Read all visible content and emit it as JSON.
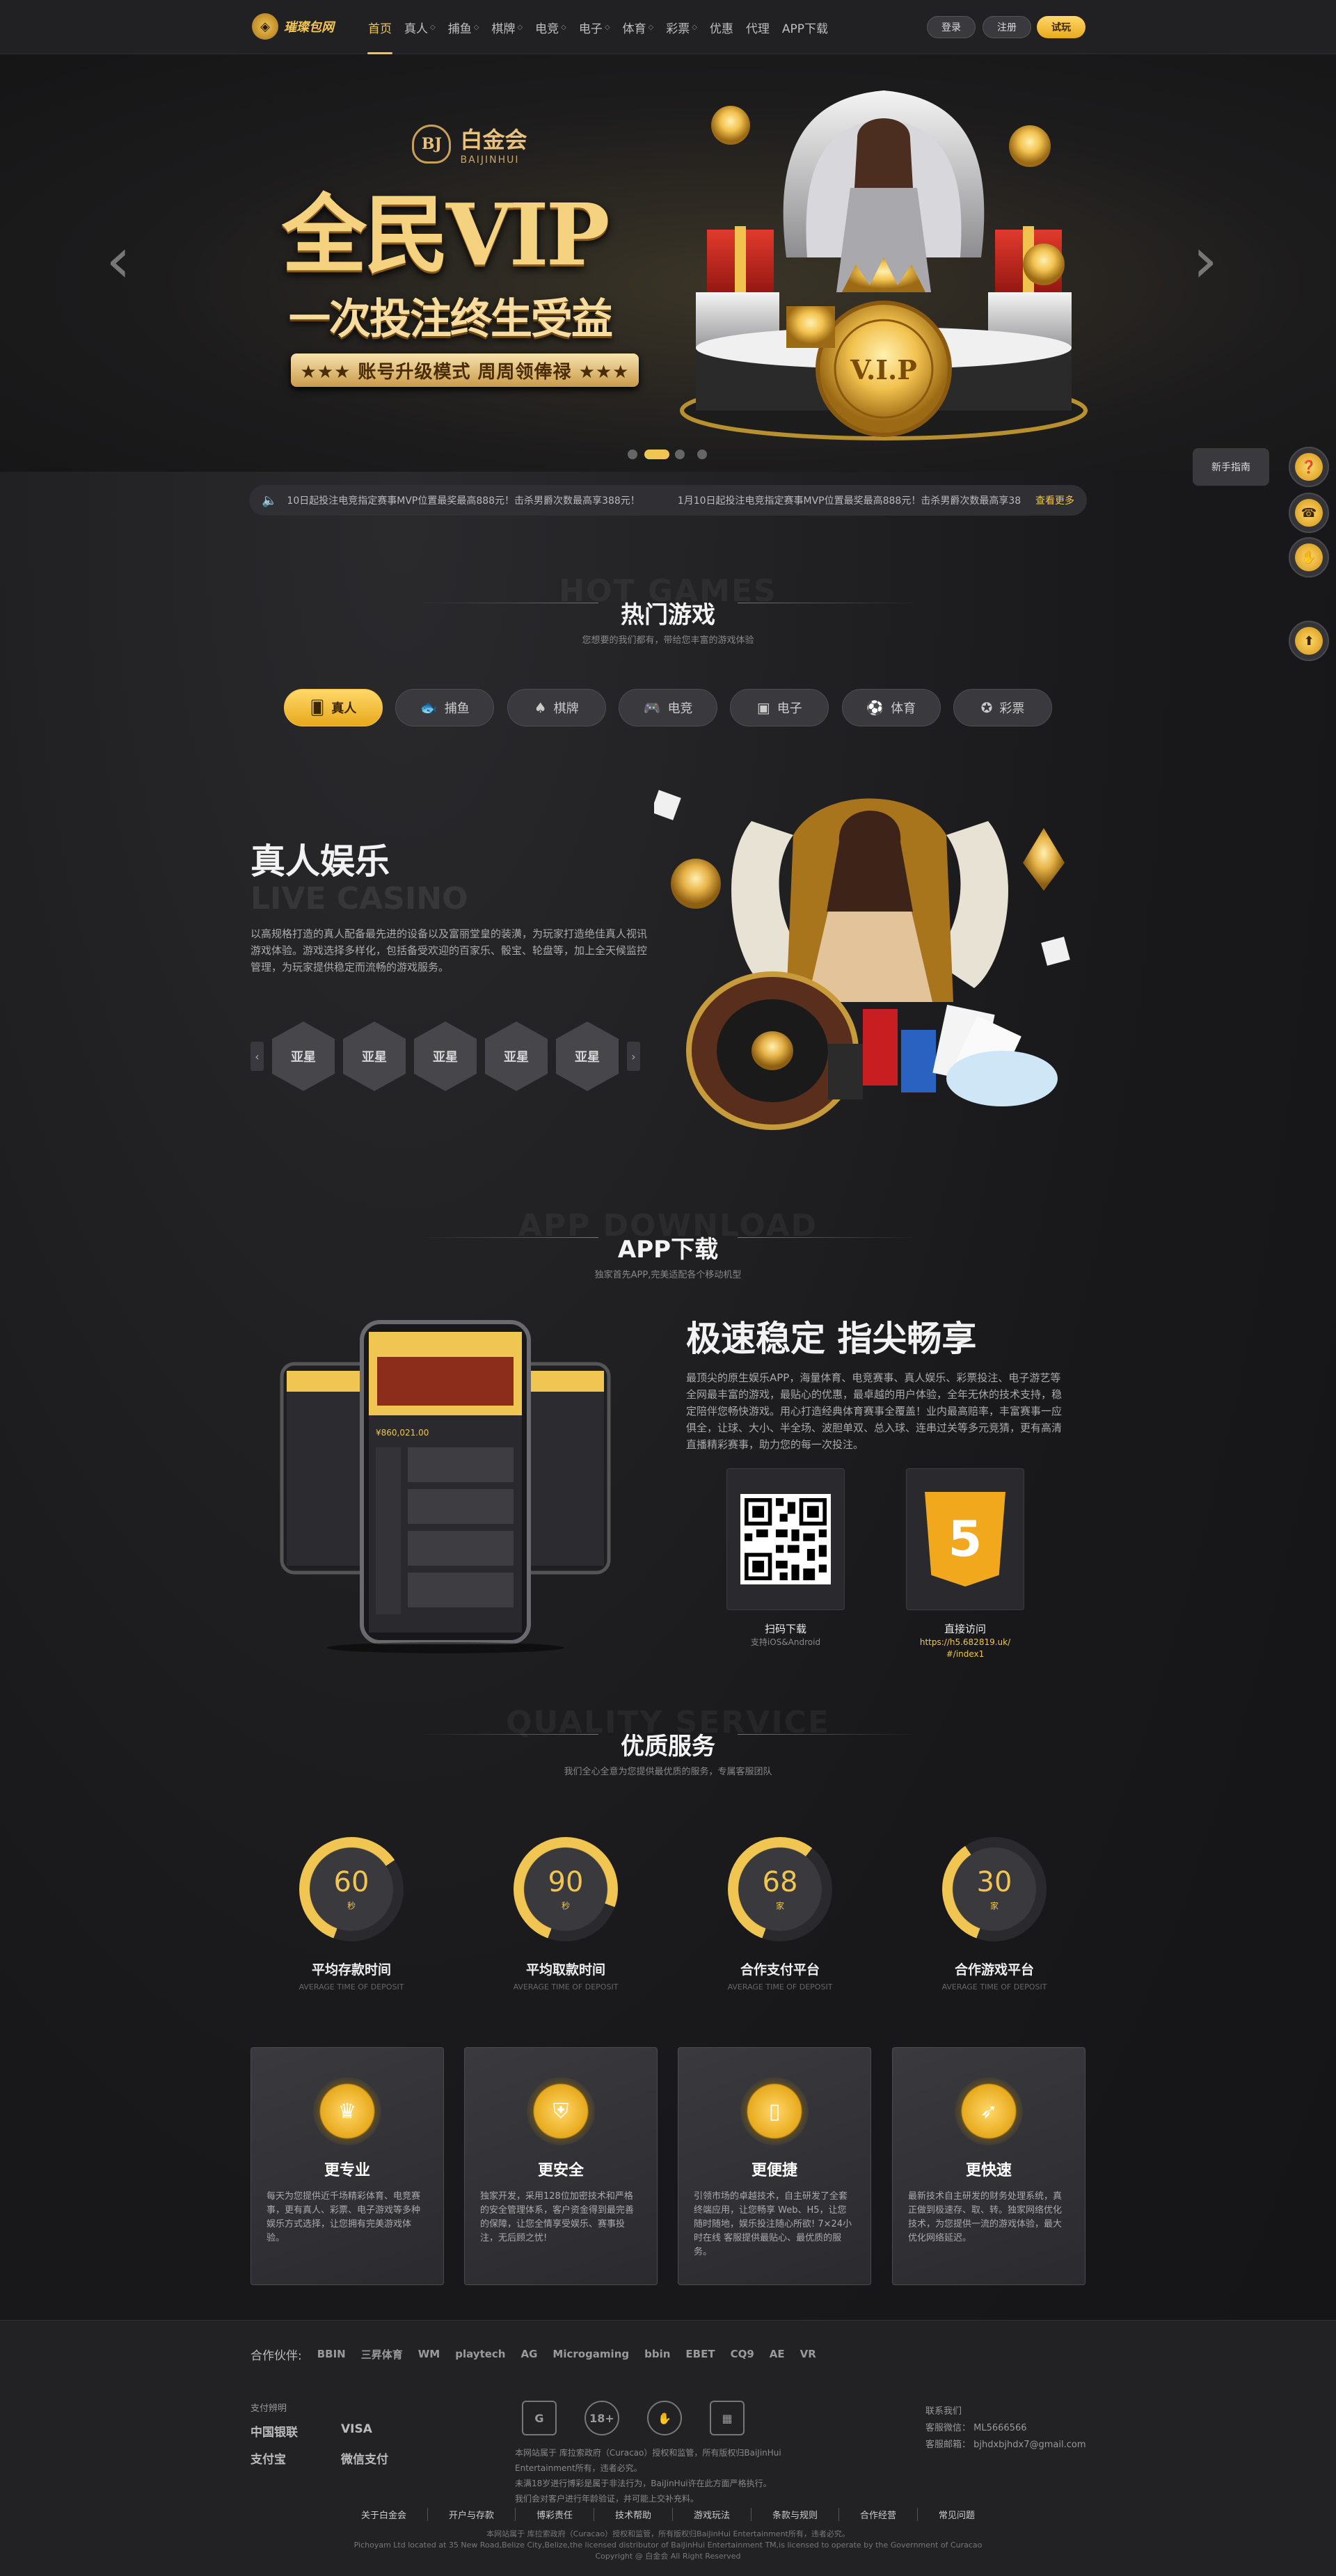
{
  "nav": {
    "logo_text": "璀璨包网",
    "items": [
      {
        "label": "首页",
        "active": true,
        "dropdown": false
      },
      {
        "label": "真人",
        "active": false,
        "dropdown": true
      },
      {
        "label": "捕鱼",
        "active": false,
        "dropdown": true
      },
      {
        "label": "棋牌",
        "active": false,
        "dropdown": true
      },
      {
        "label": "电竞",
        "active": false,
        "dropdown": true
      },
      {
        "label": "电子",
        "active": false,
        "dropdown": true
      },
      {
        "label": "体育",
        "active": false,
        "dropdown": true
      },
      {
        "label": "彩票",
        "active": false,
        "dropdown": true
      },
      {
        "label": "优惠",
        "active": false,
        "dropdown": false
      },
      {
        "label": "代理",
        "active": false,
        "dropdown": false
      },
      {
        "label": "APP下载",
        "active": false,
        "dropdown": false
      }
    ],
    "login": "登录",
    "register": "注册",
    "trial": "试玩"
  },
  "banner": {
    "brand_cn": "白金会",
    "brand_en": "BAIJINHUI",
    "crest": "BJ",
    "title": "全民VIP",
    "subtitle": "一次投注终生受益",
    "ribbon": "★★★ 账号升级模式 周周领俸禄 ★★★",
    "coin_text": "V.I.P",
    "slides": 4,
    "active_slide": 2
  },
  "marquee": {
    "text1": "10日起投注电竞指定赛事MVP位置最奖最高888元！击杀男爵次数最高享388元！",
    "text2": "1月10日起投注电竞指定赛事MVP位置最奖最高888元！击杀男爵次数最高享38",
    "more": "查看更多"
  },
  "side": {
    "guide": "新手指南"
  },
  "hot": {
    "bg": "HOT GAMES",
    "title": "热门游戏",
    "sub": "您想要的我们都有，带给您丰富的游戏体验",
    "tabs": [
      {
        "label": "真人",
        "icon": "cards-icon",
        "glyph": "🂠",
        "active": true
      },
      {
        "label": "捕鱼",
        "icon": "fish-icon",
        "glyph": "🐟",
        "active": false
      },
      {
        "label": "棋牌",
        "icon": "spade-icon",
        "glyph": "♠",
        "active": false
      },
      {
        "label": "电竞",
        "icon": "gamepad-icon",
        "glyph": "🎮",
        "active": false
      },
      {
        "label": "电子",
        "icon": "slot-icon",
        "glyph": "▣",
        "active": false
      },
      {
        "label": "体育",
        "icon": "football-icon",
        "glyph": "⚽",
        "active": false
      },
      {
        "label": "彩票",
        "icon": "lottery-icon",
        "glyph": "✪",
        "active": false
      }
    ]
  },
  "live": {
    "title": "真人娱乐",
    "en": "LIVE CASINO",
    "desc": "以高规格打造的真人配备最先进的设备以及富丽堂皇的装潢，为玩家打造绝佳真人视讯游戏体验。游戏选择多样化，包括备受欢迎的百家乐、骰宝、轮盘等，加上全天候监控管理，为玩家提供稳定而流畅的游戏服务。",
    "providers": [
      "亚星",
      "亚星",
      "亚星",
      "亚星",
      "亚星"
    ]
  },
  "app": {
    "bg": "APP DOWNLOAD",
    "title": "APP下载",
    "sub": "独家首先APP,完美适配各个移动机型",
    "heading": "极速稳定 指尖畅享",
    "desc": "最顶尖的原生娱乐APP，海量体育、电竞赛事、真人娱乐、彩票投注、电子游艺等全网最丰富的游戏，最贴心的优惠，最卓越的用户体验，全年无休的技术支持，稳定陪伴您畅快游戏。用心打造经典体育赛事全覆盖！业内最高赔率，丰富赛事一应俱全，让球、大小、半全场、波胆单双、总入球、连串过关等多元竞猜，更有高清直播精彩赛事，助力您的每一次投注。",
    "qr_label": "扫码下载",
    "qr_sub": "支持iOS&Android",
    "h5_label": "直接访问",
    "h5_url": "https://h5.682819.uk/#/index1",
    "h5_glyph": "5",
    "phone_amount": "¥860,021.00"
  },
  "quality": {
    "bg": "QUALITY SERVICE",
    "title": "优质服务",
    "sub": "我们全心全意为您提供最优质的服务，专属客服团队",
    "stats": [
      {
        "value": "60",
        "unit": "秒",
        "label": "平均存款时间",
        "en": "AVERAGE TIME OF DEPOSIT",
        "fill": 0.6
      },
      {
        "value": "90",
        "unit": "秒",
        "label": "平均取款时间",
        "en": "AVERAGE TIME OF DEPOSIT",
        "fill": 0.75
      },
      {
        "value": "68",
        "unit": "家",
        "label": "合作支付平台",
        "en": "AVERAGE TIME OF DEPOSIT",
        "fill": 0.55
      },
      {
        "value": "30",
        "unit": "家",
        "label": "合作游戏平台",
        "en": "AVERAGE TIME OF DEPOSIT",
        "fill": 0.35
      }
    ],
    "cards": [
      {
        "title": "更专业",
        "icon": "medal-icon",
        "glyph": "♛",
        "desc": "每天为您提供近千场精彩体育、电竞赛事，更有真人、彩票、电子游戏等多种娱乐方式选择，让您拥有完美游戏体验。"
      },
      {
        "title": "更安全",
        "icon": "shield-icon",
        "glyph": "⛨",
        "desc": "独家开发，采用128位加密技术和严格的安全管理体系，客户资金得到最完善的保障，让您全情享受娱乐、赛事投注，无后顾之忧!"
      },
      {
        "title": "更便捷",
        "icon": "phone-icon",
        "glyph": "▯",
        "desc": "引领市场的卓越技术，自主研发了全套终端应用，让您畅享 Web、H5，让您随时随地，娱乐投注随心所欲! 7×24小时在线 客服提供最贴心、最优质的服务。"
      },
      {
        "title": "更快速",
        "icon": "rocket-icon",
        "glyph": "➶",
        "desc": "最新技术自主研发的财务处理系统，真正做到极速存、取、转。独家网络优化技术，为您提供一流的游戏体验，最大优化网络延迟。"
      }
    ]
  },
  "footer": {
    "partners_label": "合作伙伴:",
    "partners": [
      "BBIN",
      "三昇体育",
      "WM",
      "playtech",
      "AG",
      "Microgaming",
      "bbin",
      "EBET",
      "CQ9",
      "AE",
      "VR"
    ],
    "pay_label": "支付辨明",
    "pay": [
      "中国银联",
      "VISA",
      "支付宝",
      "微信支付"
    ],
    "licenses": [
      "G",
      "18+",
      "✋",
      "▦"
    ],
    "lic_text1": "本网站属于 库拉索政府（Curacao）授权和监管，所有版权归BaiJinHui Entertainment所有，违者必究。",
    "lic_text2": "未满18岁进行博彩是属于非法行为，BaiJinHui许在此方面严格执行。",
    "lic_text3": "我们会对客户进行年龄验证，并可能上交补充料。",
    "contact_label": "联系我们",
    "contact_wechat": "客服微信：  ML5666566",
    "contact_email": "客服邮箱：  bjhdxbjhdx7@gmail.com",
    "links": [
      "关于白金会",
      "开户与存款",
      "博彩责任",
      "技术帮助",
      "游戏玩法",
      "条款与规则",
      "合作经营",
      "常见问题"
    ],
    "copy1": "本网站属于 库拉索政府（Curacao）授权和监管，所有版权归BaiJinHui Entertainment所有，违者必究。",
    "copy2": "Pichoyam Ltd located at 35 New Road,Belize City,Belize,the licensed distributor of BaiJinHui Entertainment TM,is licensed to operate by the Government of Curacao",
    "copy3": "Copyright @ 白金会 All Right Reserved"
  },
  "colors": {
    "accent": "#f0c552",
    "background": "#1a1a1c",
    "card": "#2f2f33"
  }
}
